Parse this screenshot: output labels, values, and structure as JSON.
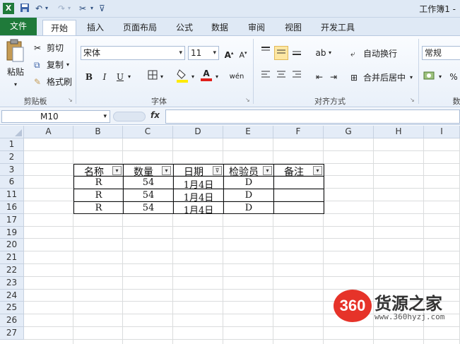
{
  "app": {
    "title": "工作簿1 -",
    "quick_access": {
      "undo_glyph": "↶",
      "redo_glyph": "↷",
      "save_icon": "save-icon"
    }
  },
  "tabs": [
    {
      "label": "文件"
    },
    {
      "label": "开始"
    },
    {
      "label": "插入"
    },
    {
      "label": "页面布局"
    },
    {
      "label": "公式"
    },
    {
      "label": "数据"
    },
    {
      "label": "审阅"
    },
    {
      "label": "视图"
    },
    {
      "label": "开发工具"
    }
  ],
  "ribbon": {
    "clipboard": {
      "paste": "粘贴",
      "cut": "剪切",
      "copy": "复制",
      "format_painter": "格式刷",
      "group_label": "剪贴板"
    },
    "font": {
      "name": "宋体",
      "size": "11",
      "bold": "B",
      "italic": "I",
      "underline": "U",
      "wen": "wén",
      "group_label": "字体",
      "font_color": "#e0201b",
      "fill_color": "#ffea00"
    },
    "alignment": {
      "wrap_text": "自动换行",
      "merge_center": "合并后居中",
      "group_label": "对齐方式"
    },
    "number": {
      "format": "常规",
      "percent": "%",
      "group_label": "数"
    }
  },
  "formula_bar": {
    "name_box": "M10",
    "fx": "fx",
    "value": ""
  },
  "columns": [
    "A",
    "B",
    "C",
    "D",
    "E",
    "F",
    "G",
    "H",
    "I"
  ],
  "rows": [
    "1",
    "2",
    "3",
    "6",
    "11",
    "16",
    "17",
    "19",
    "20",
    "21",
    "22",
    "23",
    "24",
    "25",
    "26",
    "27"
  ],
  "table": {
    "headers": [
      "名称",
      "数量",
      "日期",
      "检验员",
      "备注"
    ],
    "rows": [
      [
        "R",
        "54",
        "1月4日",
        "D",
        ""
      ],
      [
        "R",
        "54",
        "1月4日",
        "D",
        ""
      ],
      [
        "R",
        "54",
        "1月4日",
        "D",
        ""
      ]
    ]
  },
  "watermark": {
    "badge": "360",
    "name": "货源之家",
    "url": "www.360hyzj.com"
  }
}
